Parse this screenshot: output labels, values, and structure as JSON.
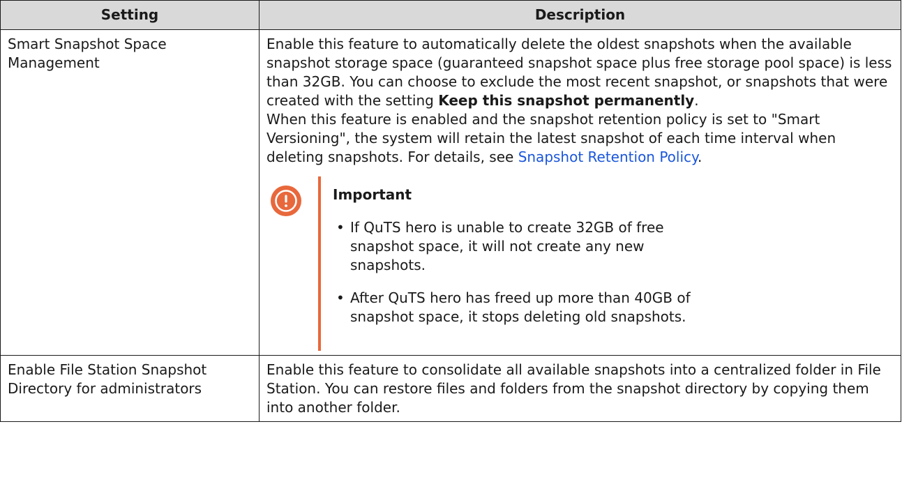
{
  "table": {
    "headers": {
      "setting": "Setting",
      "description": "Description"
    },
    "rows": [
      {
        "setting": "Smart Snapshot Space Management",
        "para1_text": "Enable this feature to automatically delete the oldest snapshots when the available snapshot storage space (guaranteed snapshot space plus free storage pool space) is less than 32GB. You can choose to exclude the most recent snapshot, or snapshots that were created with the setting ",
        "para1_bold": "Keep this snapshot permanently",
        "para1_end": ".",
        "para2_text": "When this feature is enabled and the snapshot retention policy is set to \"Smart Versioning\", the system will retain the latest snapshot of each time interval when deleting snapshots. For details, see ",
        "para2_link": "Snapshot Retention Policy",
        "para2_end": ".",
        "callout": {
          "title": "Important",
          "items": [
            "If QuTS hero is unable to create 32GB of free snapshot space, it will not create any new snapshots.",
            "After QuTS hero has freed up more than 40GB of snapshot space, it stops deleting old snapshots."
          ]
        }
      },
      {
        "setting": "Enable File Station Snapshot Directory for administrators",
        "description": "Enable this feature to consolidate all available snapshots into a centralized folder in File Station. You can restore files and folders from the snapshot directory by copying them into another folder."
      }
    ]
  },
  "colors": {
    "header_bg": "#d9d9d9",
    "border": "#1a1a1a",
    "link": "#1a56db",
    "callout_accent": "#e8683c"
  },
  "icons": {
    "callout": "exclamation-circle-icon"
  }
}
